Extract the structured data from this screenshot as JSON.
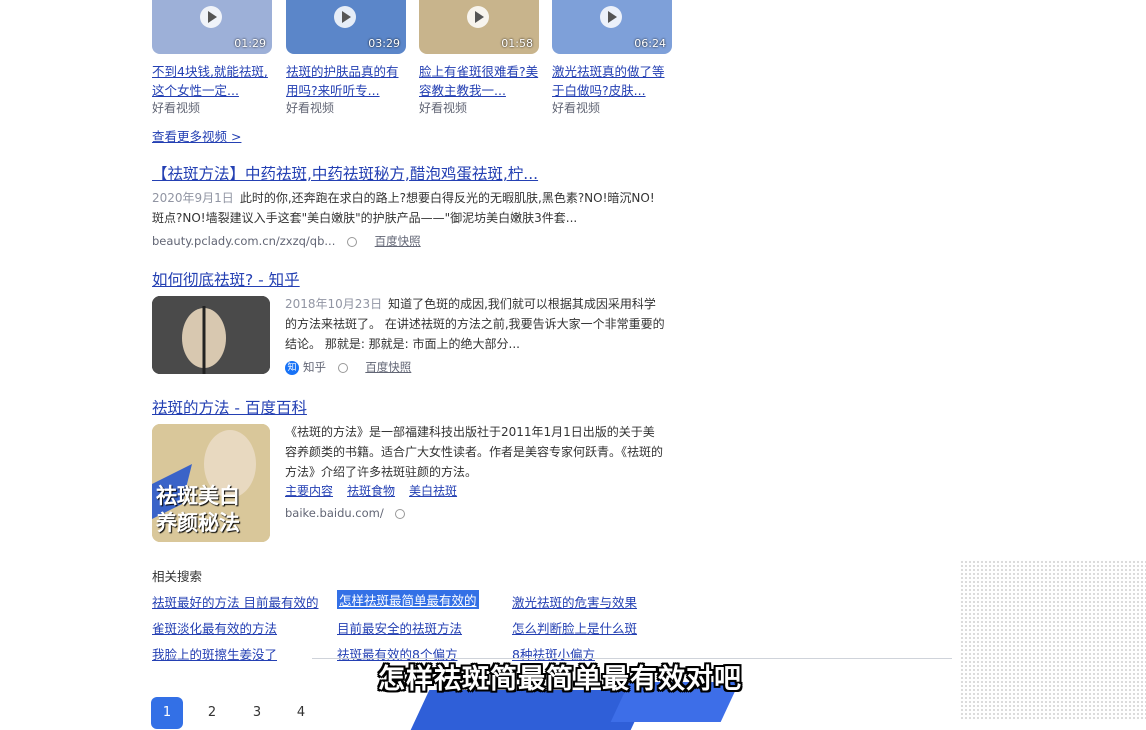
{
  "videos": [
    {
      "title": "不到4块钱,就能祛斑,这个女性一定...",
      "source": "好看视频",
      "duration": "01:29"
    },
    {
      "title": "祛斑的护肤品真的有用吗?来听听专...",
      "source": "好看视频",
      "duration": "03:29"
    },
    {
      "title": "脸上有雀斑很难看?美容教主教我一...",
      "source": "好看视频",
      "duration": "01:58"
    },
    {
      "title": "激光祛斑真的做了等于白做吗?皮肤...",
      "source": "好看视频",
      "duration": "06:24"
    }
  ],
  "more_videos": "查看更多视频 >",
  "results": [
    {
      "title": "【祛斑方法】中药祛斑,中药祛斑秘方,醋泡鸡蛋祛斑,柠...",
      "date": "2020年9月1日",
      "abstract": "此时的你,还奔跑在求白的路上?想要白得反光的无暇肌肤,黑色素?NO!暗沉NO!斑点?NO!墙裂建议入手这套\"美白嫩肤\"的护肤产品——\"御泥坊美白嫩肤3件套...",
      "url": "beauty.pclady.com.cn/zxzq/qb...",
      "snapshot": "百度快照"
    },
    {
      "title": "如何彻底祛斑? - 知乎",
      "date": "2018年10月23日",
      "abstract": "知道了色斑的成因,我们就可以根据其成因采用科学的方法来祛斑了。 在讲述祛斑的方法之前,我要告诉大家一个非常重要的结论。 那就是: 那就是: 市面上的绝大部分...",
      "source": "知乎",
      "badge": "知",
      "snapshot": "百度快照"
    },
    {
      "title": "祛斑的方法 - 百度百科",
      "abstract": "《祛斑的方法》是一部福建科技出版社于2011年1月1日出版的关于美容养颜类的书籍。适合广大女性读者。作者是美容专家何跃青。《祛斑的方法》介绍了许多祛斑驻颜的方法。",
      "sub_links": [
        "主要内容",
        "祛斑食物",
        "美白祛斑"
      ],
      "url": "baike.baidu.com/",
      "thumb_text": [
        "祛斑美白",
        "养颜秘法"
      ]
    }
  ],
  "related": {
    "heading": "相关搜索",
    "items": [
      "祛斑最好的方法 目前最有效的",
      "怎样祛斑最简单最有效的",
      "激光祛斑的危害与效果",
      "雀斑淡化最有效的方法",
      "目前最安全的祛斑方法",
      "怎么判断脸上是什么斑",
      "我脸上的斑擦生姜没了",
      "祛斑最有效的8个偏方",
      "8种祛斑小偏方"
    ]
  },
  "pagination": [
    "1",
    "2",
    "3",
    "4"
  ],
  "subtitle": "怎样祛斑简最简单最有效对吧",
  "colors": {
    "link": "#2440b3",
    "highlight": "#c96d00",
    "accent": "#3370e6"
  }
}
